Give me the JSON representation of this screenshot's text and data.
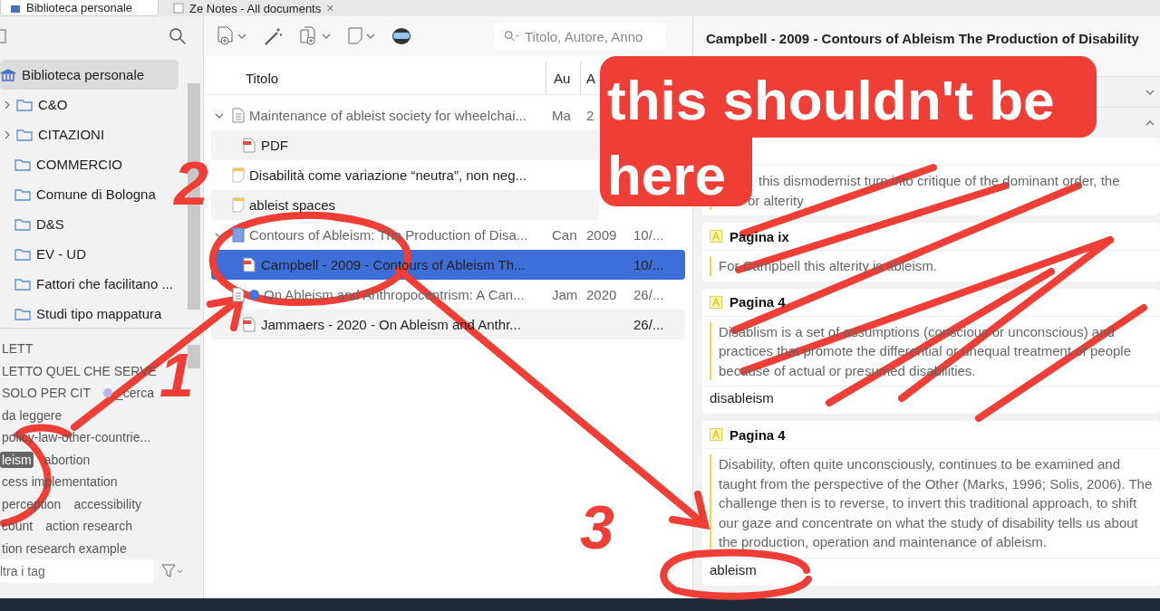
{
  "tabs": [
    {
      "label": "Biblioteca personale",
      "selected": true,
      "closable": false
    },
    {
      "label": "Ze Notes - All documents",
      "selected": false,
      "closable": true,
      "close": "×"
    }
  ],
  "collections": [
    {
      "label": "Biblioteca personale",
      "kind": "library",
      "selected": true,
      "has_children": false
    },
    {
      "label": "C&O",
      "kind": "folder",
      "selected": false,
      "has_children": true
    },
    {
      "label": "CITAZIONI",
      "kind": "folder",
      "selected": false,
      "has_children": true
    },
    {
      "label": "COMMERCIO",
      "kind": "folder",
      "selected": false,
      "has_children": false
    },
    {
      "label": "Comune di Bologna",
      "kind": "folder",
      "selected": false,
      "has_children": false
    },
    {
      "label": "D&S",
      "kind": "folder",
      "selected": false,
      "has_children": false
    },
    {
      "label": "EV - UD",
      "kind": "folder",
      "selected": false,
      "has_children": false
    },
    {
      "label": "Fattori che facilitano ...",
      "kind": "folder",
      "selected": false,
      "has_children": false
    },
    {
      "label": "Studi tipo mappatura",
      "kind": "folder",
      "selected": false,
      "has_children": false
    }
  ],
  "tag_rows": [
    [
      {
        "label": "LETT",
        "selected": false
      }
    ],
    [
      {
        "label": "LETTO QUEL CHE SERVE",
        "selected": false
      }
    ],
    [
      {
        "label": "SOLO PER CIT",
        "selected": false
      },
      {
        "label": "_cerca",
        "selected": false,
        "color": "#b9b4f0"
      }
    ],
    [
      {
        "label": "da leggere",
        "selected": false
      }
    ],
    [
      {
        "label": "policy-law-other-countrie...",
        "selected": false
      }
    ],
    [
      {
        "label": "leism",
        "selected": true
      },
      {
        "label": "abortion",
        "selected": false
      }
    ],
    [
      {
        "label": "cess implementation",
        "selected": false
      }
    ],
    [
      {
        "label": "perception",
        "selected": false
      },
      {
        "label": "accessibility",
        "selected": false
      }
    ],
    [
      {
        "label": "count",
        "selected": false
      },
      {
        "label": "action research",
        "selected": false
      }
    ],
    [
      {
        "label": "tion research example",
        "selected": false
      }
    ]
  ],
  "tag_filter": {
    "placeholder": "ltra i tag"
  },
  "search": {
    "placeholder": "Titolo, Autore, Anno"
  },
  "columns": [
    "Titolo",
    "Au",
    "A"
  ],
  "items": [
    {
      "kind": "document",
      "expanded": true,
      "selected": false,
      "child": false,
      "title": "Maintenance of ableist society for wheelchai...",
      "creator": "Ma",
      "year": "2"
    },
    {
      "kind": "pdf",
      "selected": false,
      "child": true,
      "title": "PDF"
    },
    {
      "kind": "note",
      "selected": false,
      "child": false,
      "title": "Disabilità come variazione “neutra”, non neg..."
    },
    {
      "kind": "note",
      "selected": false,
      "child": false,
      "title": "ableist spaces"
    },
    {
      "kind": "book",
      "expanded": true,
      "selected": false,
      "child": false,
      "title": "Contours of Ableism: The Production of Disa...",
      "creator": "Can",
      "year": "2009",
      "date": "10/..."
    },
    {
      "kind": "pdf",
      "selected": true,
      "child": true,
      "title": "Campbell - 2009 - Contours of Ableism Th...",
      "date": "10/..."
    },
    {
      "kind": "document",
      "selected": false,
      "child": false,
      "unread": true,
      "title": "On Ableism and Anthropocentrism: A Can...",
      "creator": "Jam",
      "year": "2020",
      "date": "26/..."
    },
    {
      "kind": "pdf",
      "selected": false,
      "child": true,
      "title": "Jammaers - 2020 - On Ableism and Anthr...",
      "date": "26/..."
    }
  ],
  "pane": {
    "title": "Campbell - 2009 - Contours of Ableism The Production of Disability",
    "annotations": [
      {
        "text": "this dismodernist turn into critique of the dominant order, the",
        "text_2": "or alterity"
      },
      {
        "header": "Pagina ix",
        "text": "For Campbell this alterity is ableism."
      },
      {
        "header": "Pagina 4",
        "text": "Disablism is a set of assumptions (conscious or unconscious) and practices that promote the differential or unequal treatment of people because of actual or presumed disabilities.",
        "tag": "disableism"
      },
      {
        "header": "Pagina 4",
        "text": "Disability, often quite unconsciously, continues to be examined and taught from the perspective of the Other (Marks, 1996; Solis, 2006). The challenge then is to reverse, to invert this traditional approach, to shift our gaze and concentrate on what the study of disability tells us about the production, operation and maintenance of ableism.",
        "tag": "ableism"
      }
    ]
  },
  "markup": {
    "callout_lines": [
      "this shouldn't be",
      "here"
    ],
    "numbers": [
      "1",
      "2",
      "3"
    ]
  }
}
